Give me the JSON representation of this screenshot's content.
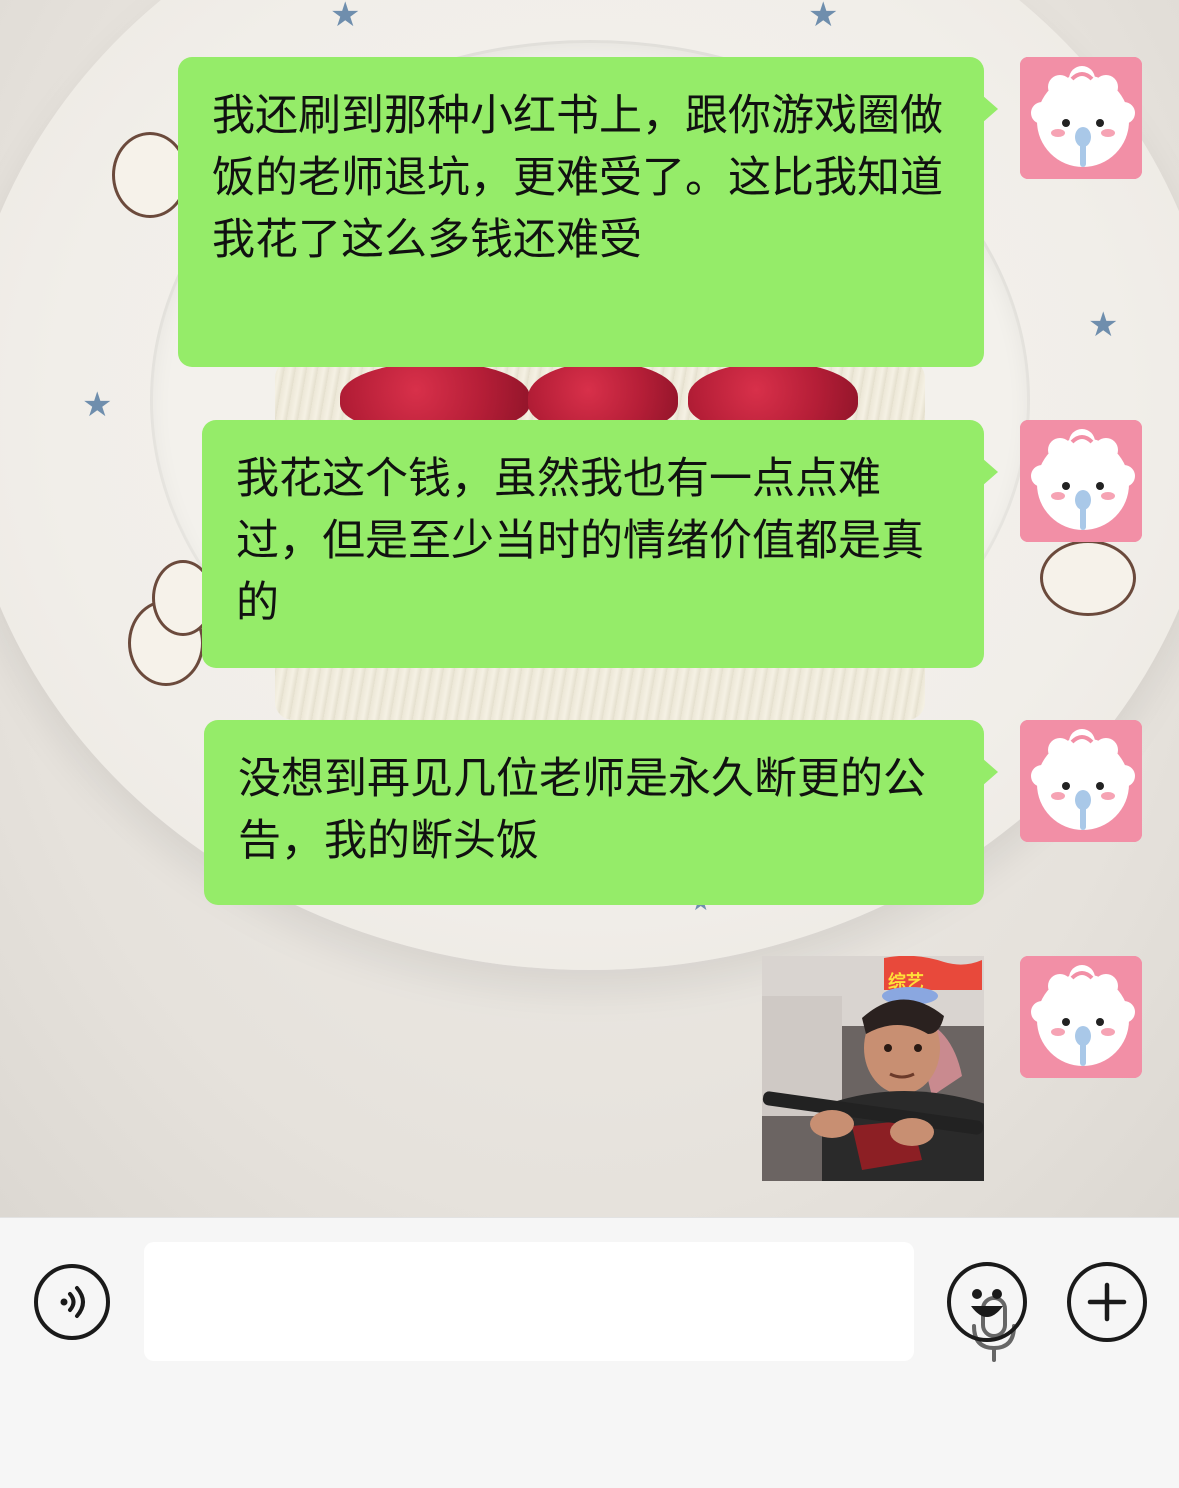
{
  "messages": [
    {
      "sender": "self",
      "type": "text",
      "text": "我还刷到那种小红书上，跟你游戏圈做饭的老师退坑，更难受了。这比我知道我花了这么多钱还难受"
    },
    {
      "sender": "self",
      "type": "text",
      "text": "我花这个钱，虽然我也有一点点难过，但是至少当时的情绪价值都是真的"
    },
    {
      "sender": "self",
      "type": "text",
      "text": "没想到再见几位老师是永久断更的公告，我的断头饭"
    },
    {
      "sender": "self",
      "type": "sticker",
      "description_icon": "meme-sticker"
    }
  ],
  "avatar": {
    "icon": "cartoon-sheep-avatar",
    "color": "#f28fa6"
  },
  "input_bar": {
    "text_value": "",
    "voice_icon": "voice-mode-icon",
    "mic_icon": "microphone-icon",
    "emoji_icon": "emoji-icon",
    "more_icon": "plus-icon"
  },
  "colors": {
    "bubble": "#95ec69",
    "input_background": "#f6f6f6"
  }
}
